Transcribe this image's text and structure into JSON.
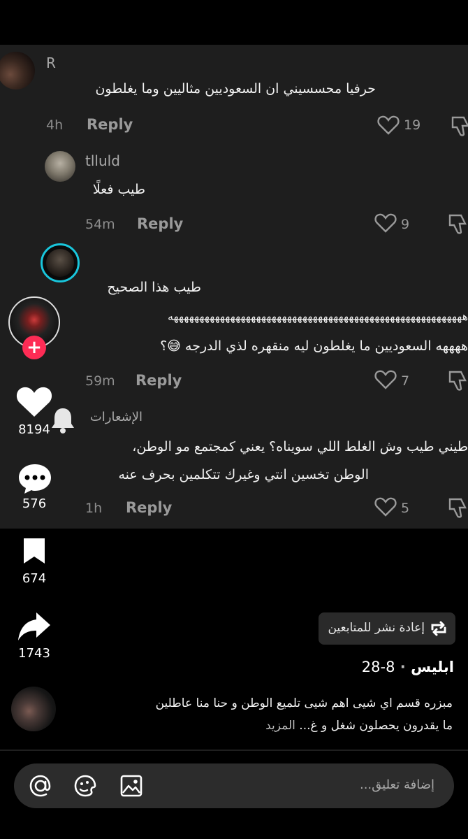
{
  "comments": [
    {
      "author": "R",
      "text": "حرفيا محسسيني ان السعوديين مثاليين وما يغلطون",
      "time": "4h",
      "reply_label": "Reply",
      "likes": "19"
    },
    {
      "author": "tlluld",
      "text": "طيب فعلًا",
      "time": "54m",
      "reply_label": "Reply",
      "likes": "9"
    },
    {
      "author": "",
      "lines": [
        "طيب هذا الصحيح",
        "هههههههههههههههههههههههههههههههههههههههههههههههههههههههههه",
        "ههههه السعوديين ما يغلطون ليه منقهره لذي الدرجه 😅؟"
      ],
      "time": "59m",
      "reply_label": "Reply",
      "likes": "7"
    },
    {
      "author": "الإشعارات",
      "lines": [
        "طيني طيب وش الغلط اللي سويناه؟ يعني كمجتمع مو الوطن،",
        "الوطن تخسين انتي وغيرك تتكلمين بحرف عنه"
      ],
      "time": "1h",
      "reply_label": "Reply",
      "likes": "5"
    }
  ],
  "rail": {
    "likes": "8194",
    "comments": "576",
    "saves": "674",
    "shares": "1743"
  },
  "repost_label": "إعادة نشر للمتابعين",
  "post": {
    "author": "ابليس",
    "date": "8-28",
    "separator": "·",
    "caption": "مبزره قسم اي شيى اهم شيى تلميع الوطن و حنا منا عاطلين ما يقدرون يحصلون شغل و غ...",
    "more": "المزيد"
  },
  "input": {
    "placeholder": "إضافة تعليق..."
  },
  "colors": {
    "accent_red": "#fe2c55",
    "story_ring": "#19c6dc",
    "panel_bg": "#1e1e1e"
  }
}
